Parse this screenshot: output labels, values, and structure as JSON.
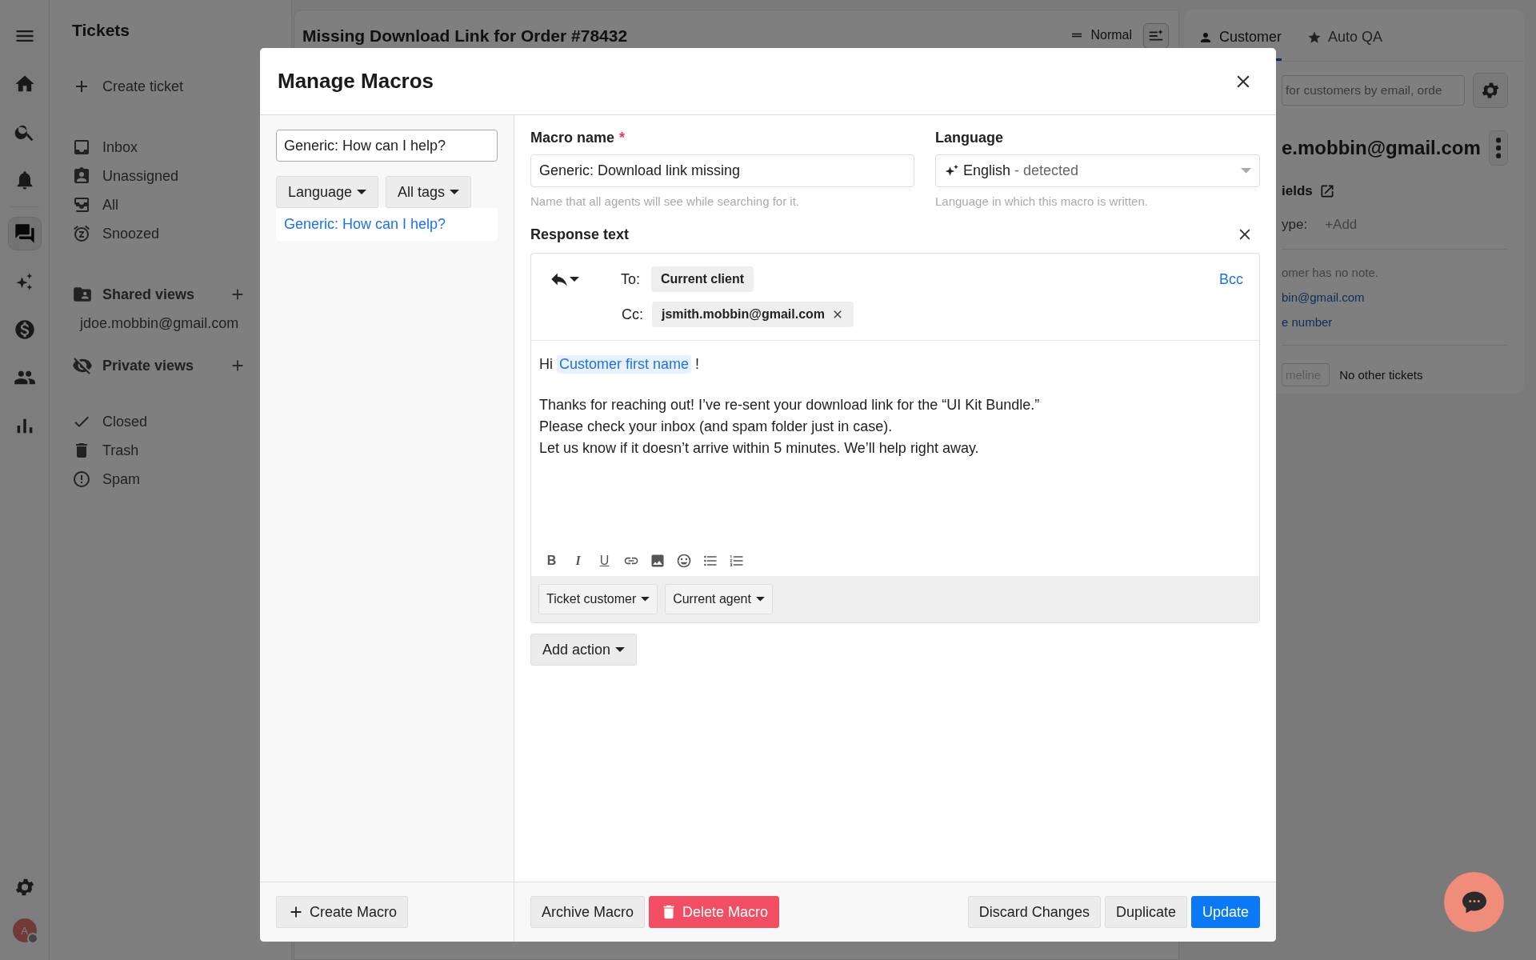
{
  "rail": {
    "items": [
      {
        "kind": "menu",
        "selected": false
      },
      {
        "kind": "home",
        "selected": false
      },
      {
        "kind": "search",
        "selected": false
      },
      {
        "kind": "bell",
        "selected": false
      },
      {
        "kind": "chat",
        "selected": true
      },
      {
        "kind": "sparkle",
        "selected": false
      },
      {
        "kind": "dollar",
        "selected": false
      },
      {
        "kind": "people",
        "selected": false
      },
      {
        "kind": "chart",
        "selected": false
      }
    ],
    "settings": {
      "kind": "gear"
    },
    "avatar": {
      "initial": "A",
      "online": false
    }
  },
  "sidebar": {
    "title": "Tickets",
    "create": "Create ticket",
    "views": [
      {
        "kind": "inbox",
        "label": "Inbox"
      },
      {
        "kind": "badge",
        "label": "Unassigned"
      },
      {
        "kind": "tray",
        "label": "All"
      },
      {
        "kind": "alarm",
        "label": "Snoozed"
      }
    ],
    "shared_views": {
      "title": "Shared views",
      "items": [
        "jdoe.mobbin@gmail.com"
      ]
    },
    "private_views": {
      "title": "Private views"
    },
    "folders": [
      {
        "kind": "check",
        "label": "Closed"
      },
      {
        "kind": "trash",
        "label": "Trash"
      },
      {
        "kind": "alert",
        "label": "Spam"
      }
    ]
  },
  "ticket": {
    "title": "Missing Download Link for Order #78432",
    "priority": "Normal"
  },
  "customer_panel": {
    "tabs": [
      {
        "label": "Customer",
        "selected": true
      },
      {
        "label": "Auto QA",
        "selected": false
      }
    ],
    "search": {
      "placeholder": "for customers by email, orde"
    },
    "name": "e.mobbin@gmail.com",
    "fields_title": "ields",
    "type_label": "ype:",
    "type_add": "+Add",
    "note": "omer has no note.",
    "email": "bin@gmail.com",
    "phone": "e number",
    "timeline": {
      "label": "meline",
      "disabled": true
    },
    "other_tickets": "No other tickets"
  },
  "modal": {
    "title": "Manage Macros",
    "search": {
      "value": "Generic: How can I help?"
    },
    "filters": [
      "Language",
      "All tags"
    ],
    "macros": [
      {
        "label": "Generic: How can I help?",
        "selected": true
      }
    ],
    "create": "Create Macro",
    "name": {
      "label": "Macro name",
      "required_mark": "*",
      "value": "Generic: Download link missing",
      "hint": "Name that all agents will see while searching for it."
    },
    "language": {
      "label": "Language",
      "value": "English",
      "detected": " - detected",
      "hint": "Language in which this macro is written."
    },
    "response": {
      "label": "Response text",
      "to_label": "To:",
      "to": "Current client",
      "cc_label": "Cc:",
      "cc": "jsmith.mobbin@gmail.com",
      "bcc": "Bcc",
      "greeting": "Hi",
      "variable": "Customer first name",
      "greeting_end": "!",
      "lines": [
        "Thanks for reaching out! I’ve re-sent your download link for the “UI Kit Bundle.”",
        "Please check your inbox (and spam folder just in case).",
        "Let us know if it doesn’t arrive within 5 minutes. We’ll help right away."
      ],
      "toolbar": [
        {
          "kind": "bold",
          "label": "B"
        },
        {
          "kind": "italic",
          "label": "I"
        },
        {
          "kind": "underline",
          "label": "U"
        },
        {
          "kind": "link"
        },
        {
          "kind": "image"
        },
        {
          "kind": "emoji"
        },
        {
          "kind": "bullets"
        },
        {
          "kind": "numbers"
        }
      ],
      "variables": [
        "Ticket customer",
        "Current agent"
      ]
    },
    "add_action": "Add action",
    "footer": {
      "archive": "Archive Macro",
      "delete": "Delete Macro",
      "discard": "Discard Changes",
      "duplicate": "Duplicate",
      "update": "Update"
    }
  }
}
